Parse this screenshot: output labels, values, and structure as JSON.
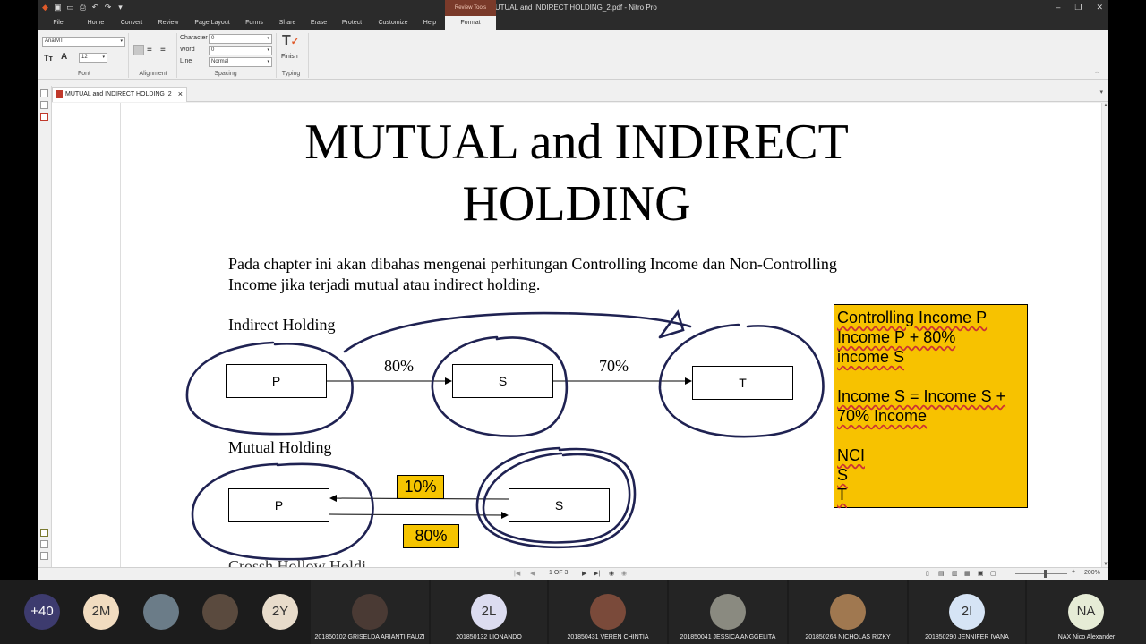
{
  "window": {
    "title": "MUTUAL and INDIRECT HOLDING_2.pdf - Nitro Pro",
    "context_tab": "Review Tools"
  },
  "ribbon_tabs": [
    "File",
    "Home",
    "Convert",
    "Review",
    "Page Layout",
    "Forms",
    "Share",
    "Erase",
    "Protect",
    "Customize",
    "Help",
    "Format"
  ],
  "ribbon": {
    "font": {
      "name": "ArialMT",
      "size": "12",
      "label": "Font"
    },
    "alignment": {
      "label": "Alignment"
    },
    "spacing": {
      "label": "Spacing",
      "character_label": "Character",
      "character_value": "0",
      "word_label": "Word",
      "word_value": "0",
      "line_label": "Line",
      "line_value": "Normal"
    },
    "typing": {
      "label": "Typing",
      "finish_label": "Finish"
    }
  },
  "doc_tab": {
    "label": "MUTUAL and INDIRECT HOLDING_2"
  },
  "slide": {
    "title_line1": "MUTUAL and INDIRECT",
    "title_line2": "HOLDING",
    "paragraph_line1": "Pada chapter ini akan dibahas mengenai perhitungan Controlling Income dan Non-Controlling",
    "paragraph_line2": "Income jika terjadi mutual atau indirect holding.",
    "indirect_heading": "Indirect Holding",
    "mutual_heading": "Mutual Holding",
    "indirect": {
      "box_p": "P",
      "box_s": "S",
      "box_t": "T",
      "pct_ps": "80%",
      "pct_st": "70%"
    },
    "mutual": {
      "box_p": "P",
      "box_s": "S",
      "pct_top": "10%",
      "pct_bottom": "80%"
    },
    "note_lines": [
      "Controlling Income P",
      "Income P + 80%",
      "income S",
      "",
      "Income S = Income S +",
      "70% Income",
      "",
      "NCI",
      "S",
      "T"
    ],
    "next_heading_partial": "Crossh Hollow Holdi"
  },
  "status": {
    "page": "1 OF 3",
    "zoom": "200%"
  },
  "participants": [
    {
      "label": "+40",
      "color": "#3d3b6e",
      "name": ""
    },
    {
      "label": "2M",
      "color": "#f1dcc0",
      "name": ""
    },
    {
      "label": "",
      "color": "#6b7c88",
      "name": ""
    },
    {
      "label": "",
      "color": "#5a4a3e",
      "name": ""
    },
    {
      "label": "2Y",
      "color": "#e8dccb",
      "name": ""
    },
    {
      "label": "",
      "color": "#4a3a34",
      "name": "201850102 GRISELDA ARIANTI FAUZI"
    },
    {
      "label": "2L",
      "color": "#dcdcf0",
      "name": "201850132 LIONANDO"
    },
    {
      "label": "",
      "color": "#7a4a3a",
      "name": "201850431 VEREN CHINTIA"
    },
    {
      "label": "",
      "color": "#8a8a80",
      "name": "201850041 JESSICA ANGGELITA"
    },
    {
      "label": "",
      "color": "#a07850",
      "name": "201850264 NICHOLAS RIZKY"
    },
    {
      "label": "2I",
      "color": "#d6e4f5",
      "name": "201850290 JENNIFER IVANA"
    },
    {
      "label": "NA",
      "color": "#e6ecd6",
      "name": "NAX Nico Alexander"
    }
  ]
}
